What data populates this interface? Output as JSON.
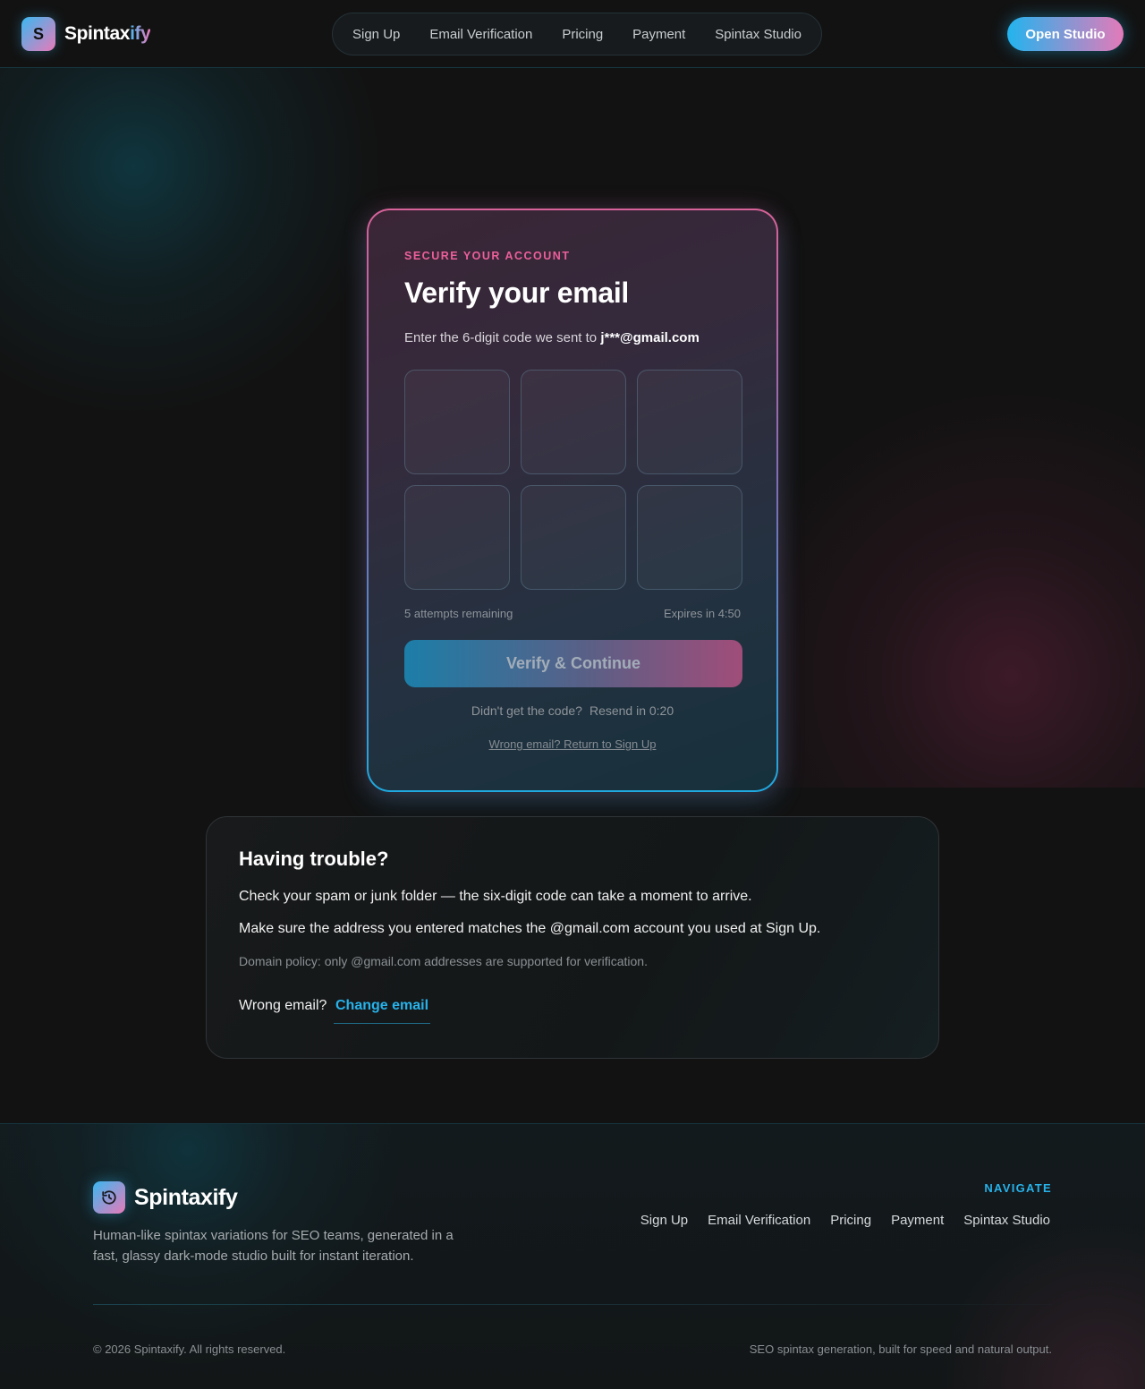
{
  "header": {
    "logo_letter": "S",
    "brand_main": "Spintax",
    "brand_suffix": "ify",
    "nav": [
      "Sign Up",
      "Email Verification",
      "Pricing",
      "Payment",
      "Spintax Studio"
    ],
    "cta": "Open Studio"
  },
  "verify": {
    "eyebrow": "SECURE YOUR ACCOUNT",
    "title": "Verify your email",
    "subtitle_prefix": "Enter the 6-digit code we sent to",
    "email_masked": "j***@gmail.com",
    "code_digits": [
      "",
      "",
      "",
      "",
      "",
      ""
    ],
    "attempts": "5 attempts remaining",
    "expires": "Expires in 4:50",
    "button": "Verify & Continue",
    "resend_prompt": "Didn't get the code?",
    "resend_timer": "Resend in 0:20",
    "return_link": "Wrong email? Return to Sign Up"
  },
  "trouble": {
    "title": "Having trouble?",
    "line1": "Check your spam or junk folder — the six-digit code can take a moment to arrive.",
    "line2": "Make sure the address you entered matches the @gmail.com account you used at Sign Up.",
    "policy": "Domain policy: only @gmail.com addresses are supported for verification.",
    "wrong_label": "Wrong email?",
    "change_link": "Change email"
  },
  "footer": {
    "brand": "Spintaxify",
    "tagline": "Human-like spintax variations for SEO teams, generated in a fast, glassy dark-mode studio built for instant iteration.",
    "nav_heading": "NAVIGATE",
    "nav": [
      "Sign Up",
      "Email Verification",
      "Pricing",
      "Payment",
      "Spintax Studio"
    ],
    "copyright": "© 2026 Spintaxify. All rights reserved.",
    "right_note": "SEO spintax generation, built for speed and natural output."
  },
  "colors": {
    "accent_cyan": "#27b2ea",
    "accent_pink": "#ec5f9a",
    "background": "#121212"
  },
  "icons": {
    "footer_logo": "history-icon"
  }
}
